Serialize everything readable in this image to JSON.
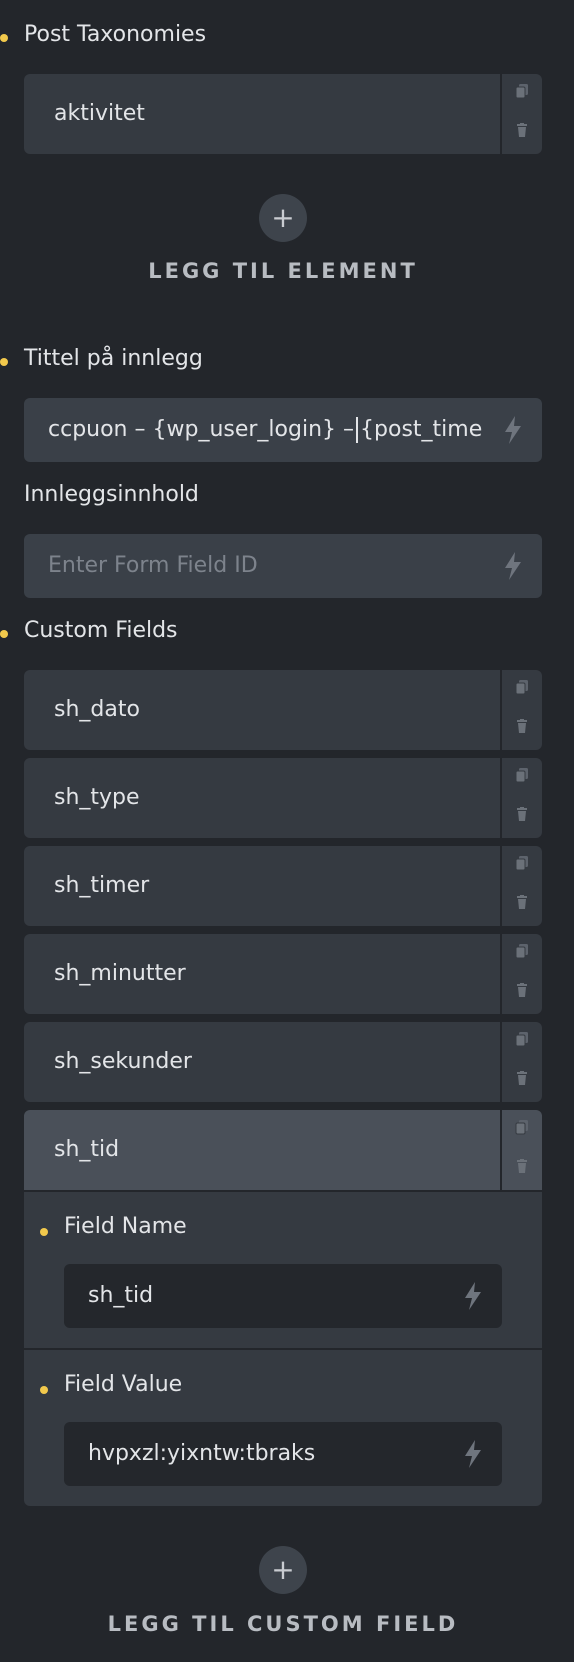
{
  "post_taxonomies": {
    "label": "Post Taxonomies",
    "items": [
      {
        "label": "aktivitet"
      }
    ],
    "add_label": "LEGG TIL ELEMENT"
  },
  "title_field": {
    "label": "Tittel på innlegg",
    "value_before_cursor": "ccpuon – {wp_user_login} –",
    "value_after_cursor": "{post_time}"
  },
  "content_field": {
    "label": "Innleggsinnhold",
    "placeholder": "Enter Form Field ID"
  },
  "custom_fields": {
    "label": "Custom Fields",
    "items": [
      {
        "label": "sh_dato"
      },
      {
        "label": "sh_type"
      },
      {
        "label": "sh_timer"
      },
      {
        "label": "sh_minutter"
      },
      {
        "label": "sh_sekunder"
      },
      {
        "label": "sh_tid"
      }
    ],
    "expanded": {
      "field_name_label": "Field Name",
      "field_name_value": "sh_tid",
      "field_value_label": "Field Value",
      "field_value_value": "hvpxzl:yixntw:tbraks"
    },
    "add_label": "LEGG TIL CUSTOM FIELD"
  },
  "colors": {
    "background": "#23262b",
    "item_bg": "#353a41",
    "active_item_bg": "#4a5059",
    "input_bg": "#3a4048",
    "accent_dot": "#f2c94c"
  },
  "icons": {
    "copy": "copy-icon",
    "delete": "trash-icon",
    "dynamic": "lightning-bolt-icon",
    "add": "plus-icon"
  }
}
